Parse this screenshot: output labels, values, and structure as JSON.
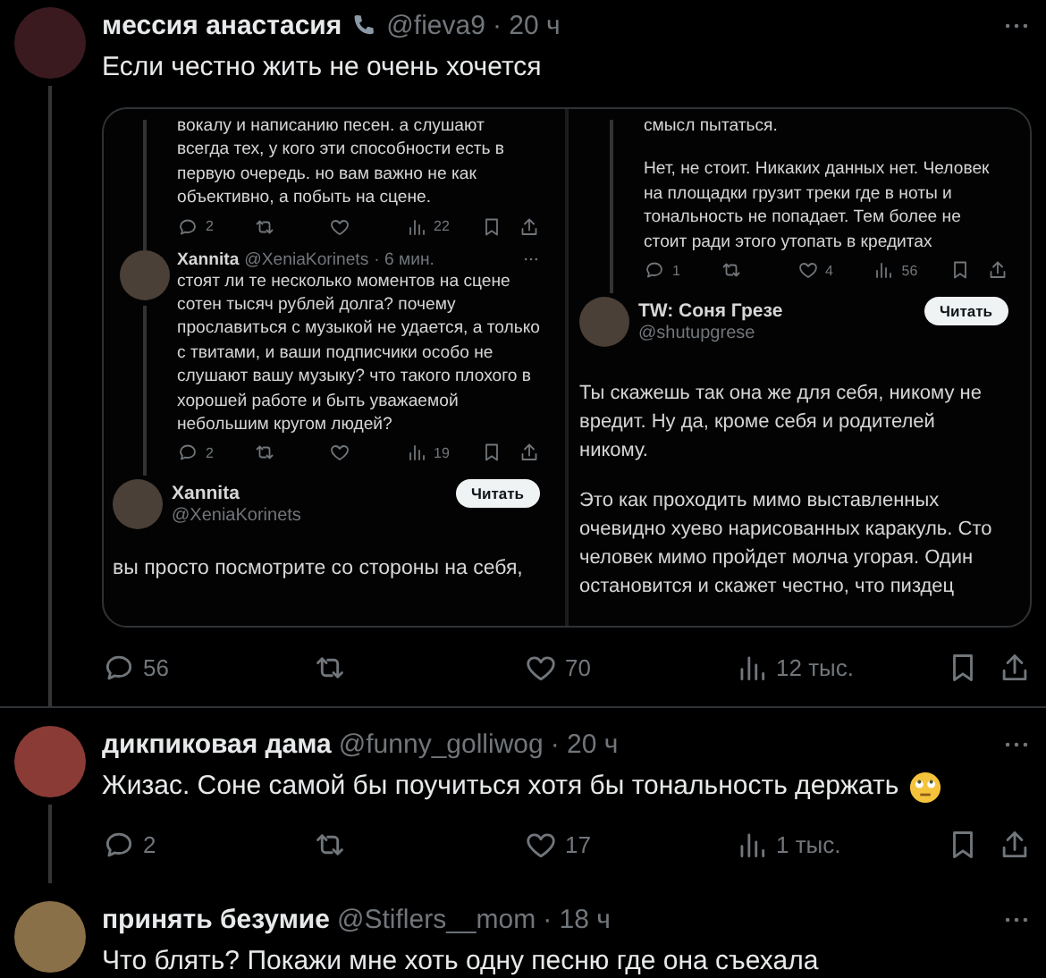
{
  "tweets": [
    {
      "name": "мессия анастасия",
      "handle": "@fieva9",
      "time": "· 20 ч",
      "text": "Если честно жить не очень хочется",
      "screenshot": {
        "left": {
          "tail": {
            "text": "вокалу и написанию песен. а слушают всегда тех, у кого эти способности есть в первую очередь. но вам важно не как объективно, а побыть на сцене.",
            "counts": {
              "replies": "2",
              "views": "22"
            }
          },
          "reply": {
            "name": "Xannita",
            "handle": "@XeniaKorinets",
            "time": "· 6 мин.",
            "text": "стоят ли те несколько моментов на сцене сотен тысяч рублей долга? почему прославиться с музыкой не удается, а только с твитами, и ваши подписчики особо не слушают вашу музыку? что такого плохого в хорошей работе и быть уважаемой небольшим кругом людей?",
            "counts": {
              "replies": "2",
              "views": "19"
            }
          },
          "profile": {
            "name": "Xannita",
            "handle": "@XeniaKorinets",
            "follow": "Читать",
            "paragraphs": [
              "вы просто посмотрите со стороны на себя,"
            ]
          }
        },
        "right": {
          "tail": {
            "paragraphs": [
              "смысл пытаться.",
              "Нет, не стоит. Никаких данных нет. Человек на площадки грузит треки где в ноты и тональность не попадает. Тем более не стоит ради этого утопать в кредитах"
            ],
            "counts": {
              "replies": "1",
              "likes": "4",
              "views": "56"
            }
          },
          "profile": {
            "name": "TW: Соня Грезе",
            "handle": "@shutupgrese",
            "follow": "Читать",
            "paragraphs": [
              "Ты скажешь так она же для себя, никому не вредит. Ну да, кроме себя и родителей никому.",
              "Это как проходить мимо выставленных очевидно хуево нарисованных каракуль. Сто человек мимо пройдет молча угорая. Один остановится и скажет честно, что пиздец"
            ]
          }
        }
      },
      "counts": {
        "replies": "56",
        "likes": "70",
        "views": "12 тыс."
      }
    },
    {
      "name": "дикпиковая дама",
      "handle": "@funny_golliwog",
      "time": "· 20 ч",
      "text": "Жизас. Соне самой бы поучиться хотя бы тональность держать",
      "has_emoji": true,
      "counts": {
        "replies": "2",
        "likes": "17",
        "views": "1 тыс."
      }
    },
    {
      "name": "принять безумие",
      "handle": "@Stiflers__mom",
      "time": "· 18 ч",
      "text": "Что блять? Покажи мне хоть одну песню где она съехала"
    }
  ]
}
